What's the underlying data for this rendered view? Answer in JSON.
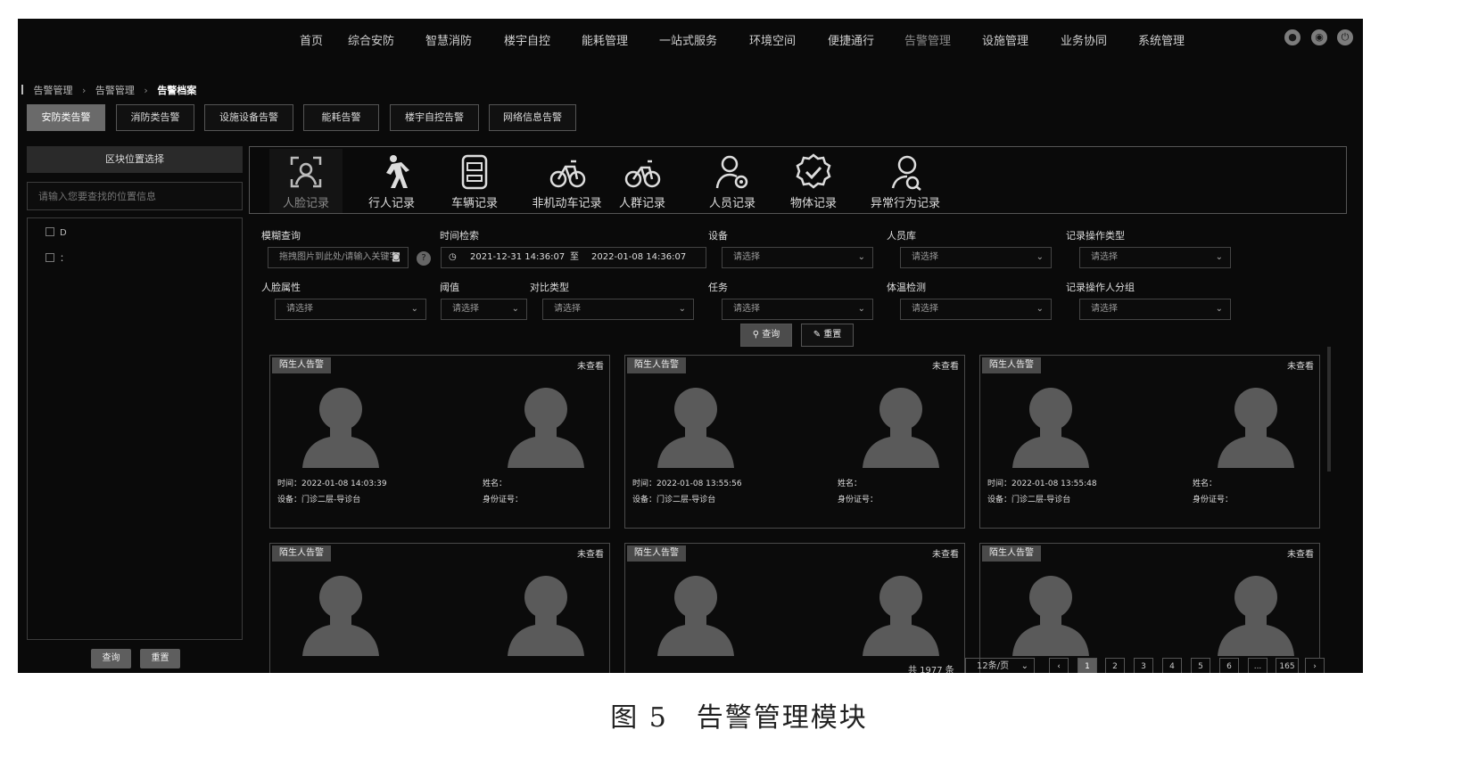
{
  "nav": {
    "items": [
      "首页",
      "综合安防",
      "智慧消防",
      "楼宇自控",
      "能耗管理",
      "一站式服务",
      "环境空间",
      "便捷通行",
      "告警管理",
      "设施管理",
      "业务协同",
      "系统管理"
    ],
    "active_index": 8
  },
  "breadcrumb": {
    "items": [
      "告警管理",
      "告警管理",
      "告警档案"
    ]
  },
  "category_tabs": {
    "items": [
      "安防类告警",
      "消防类告警",
      "设施设备告警",
      "能耗告警",
      "楼宇自控告警",
      "网络信息告警"
    ],
    "active_index": 0
  },
  "left_panel": {
    "title": "区块位置选择",
    "search_placeholder": "请输入您要查找的位置信息",
    "tree_items": [
      "D",
      "："
    ],
    "query_label": "查询",
    "reset_label": "重置"
  },
  "record_tabs": {
    "items": [
      {
        "label": "人脸记录",
        "icon": "face-scan-icon"
      },
      {
        "label": "行人记录",
        "icon": "pedestrian-icon"
      },
      {
        "label": "车辆记录",
        "icon": "car-icon"
      },
      {
        "label": "非机动车记录",
        "icon": "bicycle-icon"
      },
      {
        "label": "人群记录",
        "icon": "crowd-icon"
      },
      {
        "label": "人员记录",
        "icon": "person-gear-icon"
      },
      {
        "label": "物体记录",
        "icon": "object-check-icon"
      },
      {
        "label": "异常行为记录",
        "icon": "abnormal-behavior-icon"
      }
    ],
    "active_index": 0
  },
  "filters": {
    "fuzzy_label": "模糊查询",
    "fuzzy_placeholder": "拖拽图片到此处/请输入关键字",
    "time_label": "时间检索",
    "time_start": "2021-12-31 14:36:07",
    "time_sep": "至",
    "time_end": "2022-01-08 14:36:07",
    "device_label": "设备",
    "library_label": "人员库",
    "op_type_label": "记录操作类型",
    "face_attr_label": "人脸属性",
    "threshold_label": "阈值",
    "compare_type_label": "对比类型",
    "task_label": "任务",
    "temp_label": "体温检测",
    "op_group_label": "记录操作人分组",
    "select_placeholder": "请选择",
    "query_label": "查询",
    "reset_label": "重置"
  },
  "card_labels": {
    "time": "时间：",
    "device": "设备：",
    "name": "姓名：",
    "id": "身份证号："
  },
  "cards": [
    {
      "tag": "陌生人告警",
      "status": "未查看",
      "time": "2022-01-08 14:03:39",
      "device": "门诊二层-导诊台"
    },
    {
      "tag": "陌生人告警",
      "status": "未查看",
      "time": "2022-01-08 13:55:56",
      "device": "门诊二层-导诊台"
    },
    {
      "tag": "陌生人告警",
      "status": "未查看",
      "time": "2022-01-08 13:55:48",
      "device": "门诊二层-导诊台"
    },
    {
      "tag": "陌生人告警",
      "status": "未查看",
      "time": "",
      "device": ""
    },
    {
      "tag": "陌生人告警",
      "status": "未查看",
      "time": "",
      "device": ""
    },
    {
      "tag": "陌生人告警",
      "status": "未查看",
      "time": "",
      "device": ""
    }
  ],
  "pagination": {
    "total": "共 1977 条",
    "page_size": "12条/页",
    "pages": [
      "1",
      "2",
      "3",
      "4",
      "5",
      "6",
      "...",
      "165"
    ],
    "prev": "‹",
    "next": "›",
    "active_page": "1"
  },
  "caption": "图 5　告警管理模块"
}
